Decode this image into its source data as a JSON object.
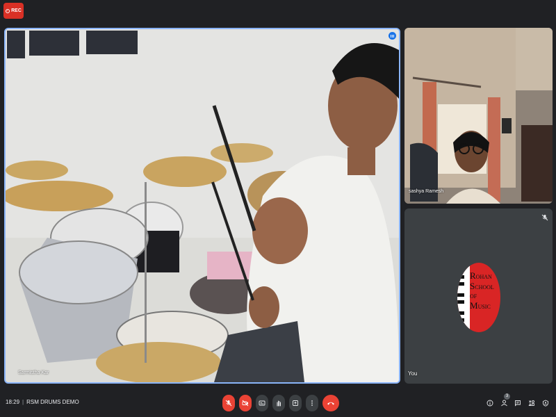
{
  "recording": {
    "label": "REC",
    "icon": "record-icon"
  },
  "main_tile": {
    "participant_name": "Sarmistha Kar",
    "speaking_icon": "speaking-indicator-icon"
  },
  "side_tiles": [
    {
      "participant_name": "sashya Ramesh"
    },
    {
      "participant_name": "You",
      "muted_icon": "mic-off-icon",
      "avatar_logo": {
        "line1_big": "R",
        "line1": "OHAN",
        "line2_big": "S",
        "line2": "CHOOL OF",
        "line3_big": "M",
        "line3": "USIC"
      }
    }
  ],
  "bottom_bar": {
    "time": "18:29",
    "separator": "|",
    "meeting_title": "RSM DRUMS DEMO",
    "controls": [
      {
        "name": "mic-toggle",
        "icon": "mic-off-icon",
        "state": "off"
      },
      {
        "name": "camera-toggle",
        "icon": "camera-off-icon",
        "state": "off"
      },
      {
        "name": "captions",
        "icon": "captions-icon",
        "state": "normal"
      },
      {
        "name": "raise-hand",
        "icon": "hand-icon",
        "state": "normal"
      },
      {
        "name": "present",
        "icon": "present-icon",
        "state": "normal"
      },
      {
        "name": "more-options",
        "icon": "more-vert-icon",
        "state": "normal"
      },
      {
        "name": "leave-call",
        "icon": "call-end-icon",
        "state": "end"
      }
    ],
    "right_icons": [
      {
        "name": "info",
        "icon": "info-icon"
      },
      {
        "name": "people",
        "icon": "people-icon",
        "badge": "3"
      },
      {
        "name": "chat",
        "icon": "chat-icon"
      },
      {
        "name": "activities",
        "icon": "activities-icon"
      },
      {
        "name": "host-controls",
        "icon": "shield-icon"
      }
    ]
  },
  "colors": {
    "accent": "#8ab4f8",
    "danger": "#ea4335",
    "rec": "#d93025",
    "background": "#202124"
  }
}
